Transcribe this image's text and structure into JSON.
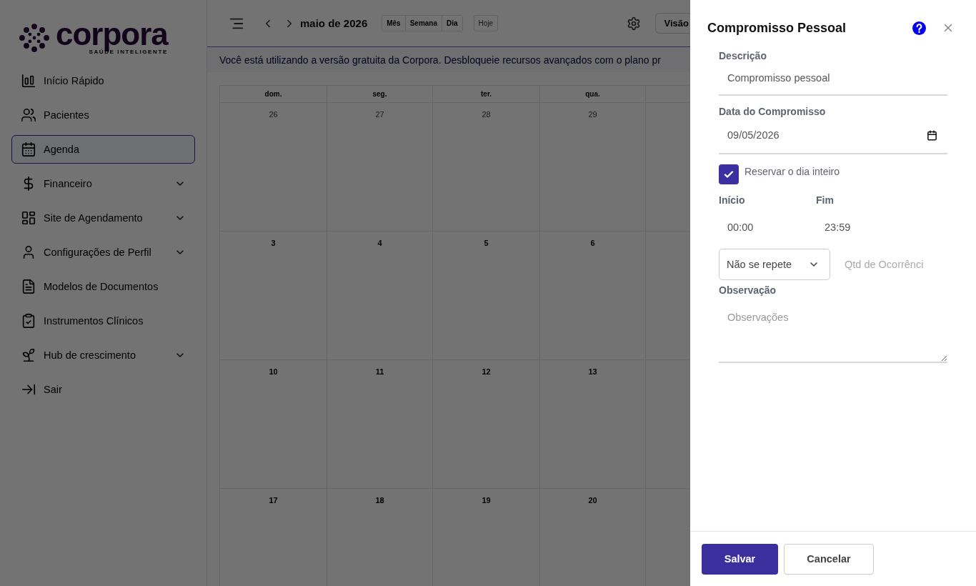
{
  "sidebar": {
    "logo": {
      "name": "corpora",
      "tagline": "SAÚDE INTELIGENTE"
    },
    "items": [
      {
        "label": "Início Rápido",
        "selected": false,
        "expandable": false
      },
      {
        "label": "Pacientes",
        "selected": false,
        "expandable": false
      },
      {
        "label": "Agenda",
        "selected": true,
        "expandable": false
      },
      {
        "label": "Financeiro",
        "selected": false,
        "expandable": true
      },
      {
        "label": "Site de Agendamento",
        "selected": false,
        "expandable": true
      },
      {
        "label": "Configurações de Perfil",
        "selected": false,
        "expandable": true
      },
      {
        "label": "Modelos de Documentos",
        "selected": false,
        "expandable": false
      },
      {
        "label": "Instrumentos Clínicos",
        "selected": false,
        "expandable": false
      },
      {
        "label": "Hub de crescimento",
        "selected": false,
        "expandable": true
      },
      {
        "label": "Sair",
        "selected": false,
        "expandable": false
      }
    ]
  },
  "toolbar": {
    "title": "maio de 2026",
    "views": [
      "Mês",
      "Semana",
      "Dia"
    ],
    "today": {
      "label": "Hoje",
      "disabled": true
    },
    "view_button": "Visão"
  },
  "banner": "Você está utilizando a versão gratuita da Corpora. Desbloqueie recursos avançados com o plano pr",
  "calendar": {
    "weekdays": [
      "dom.",
      "seg.",
      "ter.",
      "qua."
    ],
    "weeks": [
      [
        {
          "day": "26",
          "outside": true
        },
        {
          "day": "27",
          "outside": true
        },
        {
          "day": "28",
          "outside": true
        },
        {
          "day": "29",
          "outside": true
        }
      ],
      [
        {
          "day": "3",
          "outside": false
        },
        {
          "day": "4",
          "outside": false
        },
        {
          "day": "5",
          "outside": false
        },
        {
          "day": "6",
          "outside": false
        }
      ],
      [
        {
          "day": "10",
          "outside": false
        },
        {
          "day": "11",
          "outside": false
        },
        {
          "day": "12",
          "outside": false
        },
        {
          "day": "13",
          "outside": false
        }
      ],
      [
        {
          "day": "17",
          "outside": false
        },
        {
          "day": "18",
          "outside": false
        },
        {
          "day": "19",
          "outside": false
        },
        {
          "day": "20",
          "outside": false
        }
      ]
    ]
  },
  "drawer": {
    "title": "Compromisso Pessoal",
    "description": {
      "label": "Descrição",
      "value": "Compromisso pessoal"
    },
    "date": {
      "label": "Data do Compromisso",
      "value": "09/05/2026"
    },
    "all_day": {
      "label": "Reservar o dia inteiro",
      "checked": true
    },
    "start": {
      "label": "Início",
      "value": "00:00"
    },
    "end": {
      "label": "Fim",
      "value": "23:59"
    },
    "repeat": {
      "value": "Não se repete"
    },
    "occurrences": {
      "placeholder": "Qtd de Ocorrênci"
    },
    "notes": {
      "label": "Observação",
      "placeholder": "Observações"
    },
    "buttons": {
      "save": "Salvar",
      "cancel": "Cancelar"
    }
  }
}
